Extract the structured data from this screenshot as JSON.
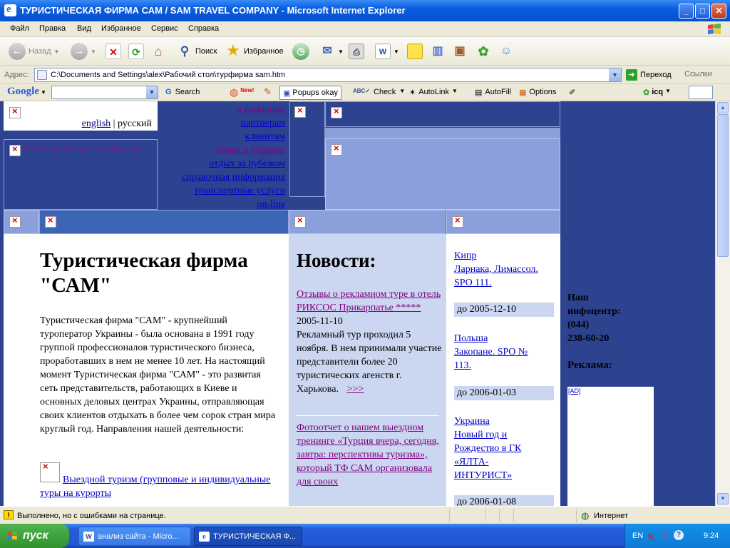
{
  "window": {
    "title": "ТУРИСТИЧЕСКАЯ ФИРМА САМ / SAM TRAVEL COMPANY - Microsoft Internet Explorer"
  },
  "menu": [
    "Файл",
    "Правка",
    "Вид",
    "Избранное",
    "Сервис",
    "Справка"
  ],
  "toolbar": {
    "back": "Назад",
    "search": "Поиск",
    "favorites": "Избранное"
  },
  "address": {
    "label": "Адрес:",
    "value": "C:\\Documents and Settings\\alex\\Рабочий стол\\турфирма sam.htm",
    "go": "Переход",
    "links": "Ссылки"
  },
  "googlebar": {
    "logo": "Google",
    "search": "Search",
    "new_badge": "New!",
    "popups": "Popups okay",
    "check": "Check",
    "autolink": "AutoLink",
    "autofill": "AutoFill",
    "options": "Options",
    "icq": "icq"
  },
  "page": {
    "lang": {
      "en": "english",
      "sep": "|",
      "ru": "русский"
    },
    "nav": [
      "о компании",
      "партнерам",
      "клиентам",
      "отдых в украине",
      "отдых за рубежом",
      "справочная информация",
      "транспортные услуги",
      "on-line"
    ],
    "logo_alt": "ТУРИСТИЧЕСКАЯ ФИРМА САМ",
    "heading": "Туристическая фирма \"САМ\"",
    "intro": "Туристическая фирма \"САМ\" - крупнейший туроператор Украины - была основана в 1991 году группой профессионалов туристического бизнеса, проработавших в нем не менее 10 лет. На настоящий момент Туристическая фирма \"САМ\" - это развитая сеть представительств, работающих в Киеве и основных деловых центрах Украины, отправляющая своих клиентов отдыхать в более чем сорок стран мира круглый год. Направления нашей деятельности:",
    "direction": "Выездной туризм (групповые и индивидуальные туры на курорты",
    "news_heading": "Новости:",
    "news": [
      {
        "title": "Отзывы о рекламном туре в отель РИКСОС Прикарпатье *****",
        "date": "2005-11-10",
        "text": "Рекламный тур проходил 5 ноября. В нем принимали участие представители более 20 туристических агенств г. Харькова.",
        "more": ">>>"
      },
      {
        "title": "Фотоотчет о нашем выездном тренинге «Турция вчера, сегодня, завтра: перспективы туризма», который ТФ САМ организовала для своих"
      }
    ],
    "offers": [
      {
        "lines": [
          "Кипр",
          "Ларнака, Лимассол.",
          "SPO 111."
        ],
        "date": "до 2005-12-10"
      },
      {
        "lines": [
          "Польша",
          "Закопане. SPO №",
          "113."
        ],
        "date": "до 2006-01-03"
      },
      {
        "lines": [
          "Украина",
          "Новый год и",
          "Рождество в ГК",
          "«ЯЛТА-",
          "ИНТУРИСТ»"
        ],
        "date": "до 2006-01-08"
      }
    ],
    "info_lines": [
      "Наш",
      "инфоцентр:",
      "(044)",
      "238-60-20"
    ],
    "ad_heading": "Реклама:",
    "ad_label": "[AD]"
  },
  "status": {
    "text": "Выполнено, но с ошибками на странице.",
    "zone": "Интернет"
  },
  "taskbar": {
    "start": "пуск",
    "tasks": [
      "анализ сайта - Micro...",
      "ТУРИСТИЧЕСКАЯ Ф..."
    ],
    "lang": "EN",
    "clock": "9:24"
  }
}
